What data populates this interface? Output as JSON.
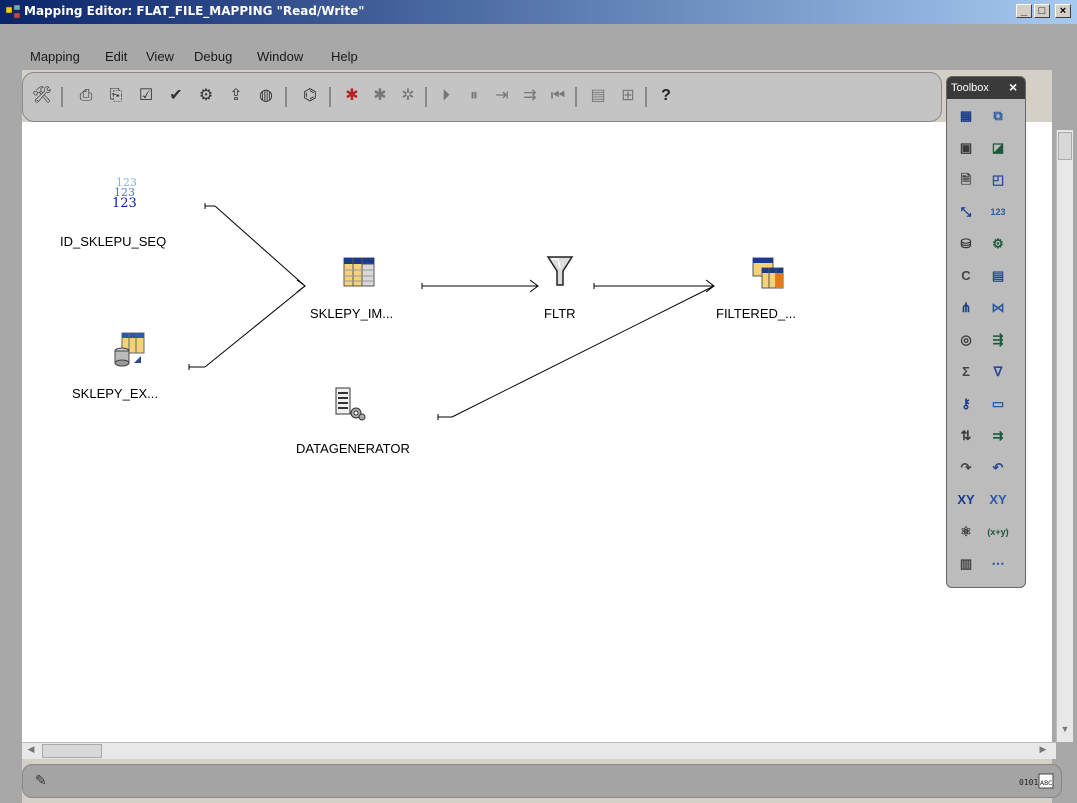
{
  "window": {
    "title": "Mapping Editor: FLAT_FILE_MAPPING \"Read/Write\""
  },
  "menu": [
    "Mapping",
    "Edit",
    "View",
    "Debug",
    "Window",
    "Help"
  ],
  "toolbar": {
    "icons": [
      "tools-icon",
      "print-icon",
      "print-setup-icon",
      "properties-icon",
      "validate-icon",
      "generate-icon",
      "deploy-icon",
      "globe-icon",
      "tag-icon",
      "debug-start-icon",
      "debug-stop-icon",
      "debug-step-icon",
      "resume-icon",
      "pause-icon",
      "step-into-icon",
      "step-over-icon",
      "reset-icon",
      "watch-icon",
      "breakpoints-icon",
      "help-icon"
    ]
  },
  "nodes": {
    "id_sklepu_seq": {
      "label": "ID_SKLEPU_SEQ",
      "icon": "sequence-icon"
    },
    "sklepy_ex": {
      "label": "SKLEPY_EX...",
      "icon": "external-table-icon"
    },
    "sklepy_im": {
      "label": "SKLEPY_IM...",
      "icon": "table-icon"
    },
    "fltr": {
      "label": "FLTR",
      "icon": "filter-icon"
    },
    "filtered": {
      "label": "FILTERED_...",
      "icon": "target-table-icon"
    },
    "datagenerator": {
      "label": "DATAGENERATOR",
      "icon": "data-generator-icon"
    }
  },
  "toolbox": {
    "title": "Toolbox",
    "close_label": "×",
    "items": [
      {
        "name": "table-icon",
        "glyph": "▦"
      },
      {
        "name": "view-icon",
        "glyph": "⧉"
      },
      {
        "name": "materialized-view-icon",
        "glyph": "▣"
      },
      {
        "name": "dimension-icon",
        "glyph": "◪"
      },
      {
        "name": "flat-file-icon",
        "glyph": "🗎"
      },
      {
        "name": "cube-icon",
        "glyph": "◰"
      },
      {
        "name": "lookup-icon",
        "glyph": "⤡"
      },
      {
        "name": "sequence-icon",
        "glyph": "123"
      },
      {
        "name": "external-table-icon",
        "glyph": "⛁"
      },
      {
        "name": "transformation-icon",
        "glyph": "⚙"
      },
      {
        "name": "constant-icon",
        "glyph": "C"
      },
      {
        "name": "mapping-input-icon",
        "glyph": "▤"
      },
      {
        "name": "splitter-icon",
        "glyph": "⋔"
      },
      {
        "name": "joiner-icon",
        "glyph": "⋈"
      },
      {
        "name": "set-operation-icon",
        "glyph": "◎"
      },
      {
        "name": "deduplicator-icon",
        "glyph": "⇶"
      },
      {
        "name": "aggregator-icon",
        "glyph": "Σ"
      },
      {
        "name": "filter-icon",
        "glyph": "∇"
      },
      {
        "name": "key-lookup-icon",
        "glyph": "⚷"
      },
      {
        "name": "expression-icon",
        "glyph": "▭"
      },
      {
        "name": "sorter-icon",
        "glyph": "⇅"
      },
      {
        "name": "pivot-icon",
        "glyph": "⇉"
      },
      {
        "name": "pre-mapping-icon",
        "glyph": "↷"
      },
      {
        "name": "post-mapping-icon",
        "glyph": "↶"
      },
      {
        "name": "name-address-icon",
        "glyph": "XY"
      },
      {
        "name": "match-merge-icon",
        "glyph": "XY"
      },
      {
        "name": "data-generator-icon",
        "glyph": "⚛"
      },
      {
        "name": "function-icon",
        "glyph": "(x+y)"
      },
      {
        "name": "table-function-icon",
        "glyph": "▥"
      },
      {
        "name": "unpivot-icon",
        "glyph": "⋯"
      }
    ]
  },
  "statusbar": {
    "left_icon": "pencil-icon",
    "right_icon": "ascii-icon"
  },
  "colors": {
    "title_start": "#0a246a",
    "title_end": "#a6caf0",
    "canvas": "#ffffff"
  }
}
